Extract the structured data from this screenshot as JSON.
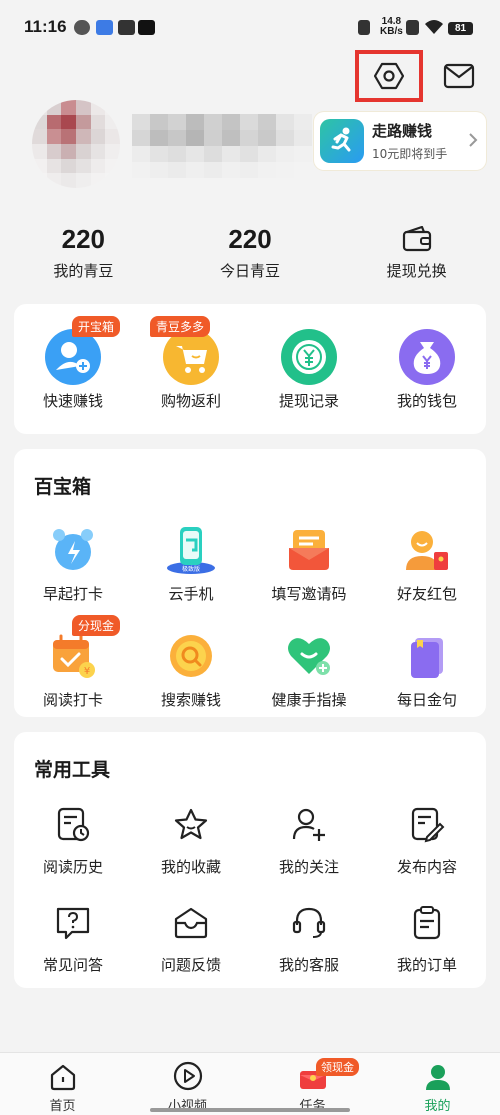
{
  "status_bar": {
    "time": "11:16",
    "net_speed": "14.8",
    "net_unit": "KB/s",
    "battery": "81"
  },
  "promo": {
    "title": "走路赚钱",
    "subtitle": "10元即将到手"
  },
  "stats": [
    {
      "value": "220",
      "label": "我的青豆"
    },
    {
      "value": "220",
      "label": "今日青豆"
    },
    {
      "label": "提现兑换",
      "icon": "wallet-icon"
    }
  ],
  "quick": [
    {
      "label": "快速赚钱",
      "tag": "开宝箱",
      "icon": "add-user-icon",
      "color": "#3aa0f5"
    },
    {
      "label": "购物返利",
      "tag": "青豆多多",
      "icon": "cart-icon",
      "color": "#f7b731"
    },
    {
      "label": "提现记录",
      "tag": "",
      "icon": "yuan-coin-icon",
      "color": "#22c08a"
    },
    {
      "label": "我的钱包",
      "tag": "",
      "icon": "money-bag-icon",
      "color": "#8a6cf0"
    }
  ],
  "treasure": {
    "title": "百宝箱",
    "items": [
      {
        "label": "早起打卡",
        "tag": "",
        "icon": "alarm-clock-icon"
      },
      {
        "label": "云手机",
        "tag": "",
        "icon": "cloud-phone-icon",
        "sub": "极致版"
      },
      {
        "label": "填写邀请码",
        "tag": "",
        "icon": "invite-code-icon"
      },
      {
        "label": "好友红包",
        "tag": "",
        "icon": "friend-red-packet-icon"
      },
      {
        "label": "阅读打卡",
        "tag": "分现金",
        "icon": "reading-calendar-icon"
      },
      {
        "label": "搜索赚钱",
        "tag": "",
        "icon": "search-coin-icon"
      },
      {
        "label": "健康手指操",
        "tag": "",
        "icon": "health-heart-icon"
      },
      {
        "label": "每日金句",
        "tag": "",
        "icon": "daily-quote-book-icon"
      }
    ]
  },
  "tools": {
    "title": "常用工具",
    "items": [
      {
        "label": "阅读历史",
        "icon": "history-icon"
      },
      {
        "label": "我的收藏",
        "icon": "star-icon"
      },
      {
        "label": "我的关注",
        "icon": "follow-user-icon"
      },
      {
        "label": "发布内容",
        "icon": "edit-icon"
      },
      {
        "label": "常见问答",
        "icon": "faq-icon"
      },
      {
        "label": "问题反馈",
        "icon": "feedback-icon"
      },
      {
        "label": "我的客服",
        "icon": "headset-icon"
      },
      {
        "label": "我的订单",
        "icon": "order-icon"
      }
    ]
  },
  "nav": [
    {
      "label": "首页",
      "icon": "home-icon",
      "badge": ""
    },
    {
      "label": "小视频",
      "icon": "play-icon",
      "badge": ""
    },
    {
      "label": "任务",
      "icon": "task-icon",
      "badge": "领现金"
    },
    {
      "label": "我的",
      "icon": "profile-icon",
      "badge": "",
      "active": true
    }
  ]
}
